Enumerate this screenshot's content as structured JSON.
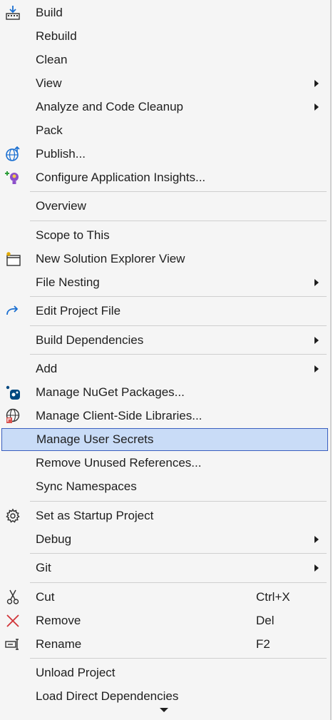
{
  "menu": {
    "items": [
      {
        "label": "Build",
        "icon": "build-icon"
      },
      {
        "label": "Rebuild"
      },
      {
        "label": "Clean"
      },
      {
        "label": "View",
        "submenu": true
      },
      {
        "label": "Analyze and Code Cleanup",
        "submenu": true
      },
      {
        "label": "Pack"
      },
      {
        "label": "Publish...",
        "icon": "publish-globe-icon"
      },
      {
        "label": "Configure Application Insights...",
        "icon": "app-insights-icon"
      },
      {
        "label": "Overview"
      },
      {
        "label": "Scope to This"
      },
      {
        "label": "New Solution Explorer View",
        "icon": "new-window-icon"
      },
      {
        "label": "File Nesting",
        "submenu": true
      },
      {
        "label": "Edit Project File",
        "icon": "edit-redo-arrow-icon"
      },
      {
        "label": "Build Dependencies",
        "submenu": true
      },
      {
        "label": "Add",
        "submenu": true
      },
      {
        "label": "Manage NuGet Packages...",
        "icon": "nuget-icon"
      },
      {
        "label": "Manage Client-Side Libraries...",
        "icon": "client-libraries-icon"
      },
      {
        "label": "Manage User Secrets",
        "highlighted": true
      },
      {
        "label": "Remove Unused References..."
      },
      {
        "label": "Sync Namespaces"
      },
      {
        "label": "Set as Startup Project",
        "icon": "gear-icon"
      },
      {
        "label": "Debug",
        "submenu": true
      },
      {
        "label": "Git",
        "submenu": true
      },
      {
        "label": "Cut",
        "icon": "scissors-icon",
        "shortcut": "Ctrl+X"
      },
      {
        "label": "Remove",
        "icon": "close-x-icon",
        "shortcut": "Del"
      },
      {
        "label": "Rename",
        "icon": "rename-icon",
        "shortcut": "F2"
      },
      {
        "label": "Unload Project"
      },
      {
        "label": "Load Direct Dependencies"
      }
    ]
  },
  "colors": {
    "highlight_bg": "#c9dcf7",
    "highlight_border": "#3a5fbf",
    "menu_bg": "#f5f5f5",
    "accent_blue": "#1a6fd1",
    "remove_red": "#d13438"
  }
}
